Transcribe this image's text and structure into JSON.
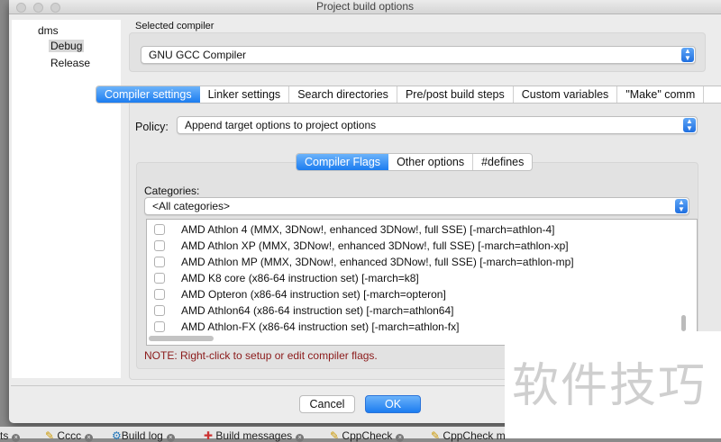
{
  "window": {
    "title": "Project build options"
  },
  "tree": {
    "root": "dms",
    "items": [
      "Debug",
      "Release"
    ],
    "selected": "Debug"
  },
  "compiler": {
    "label": "Selected compiler",
    "value": "GNU GCC Compiler"
  },
  "main_tabs": [
    "Compiler settings",
    "Linker settings",
    "Search directories",
    "Pre/post build steps",
    "Custom variables",
    "\"Make\" comm"
  ],
  "policy": {
    "label": "Policy:",
    "value": "Append target options to project options"
  },
  "sub_tabs": [
    "Compiler Flags",
    "Other options",
    "#defines"
  ],
  "categories": {
    "label": "Categories:",
    "value": "<All categories>"
  },
  "flags": [
    "AMD Athlon 4 (MMX, 3DNow!, enhanced 3DNow!, full SSE)  [-march=athlon-4]",
    "AMD Athlon XP (MMX, 3DNow!, enhanced 3DNow!, full SSE)  [-march=athlon-xp]",
    "AMD Athlon MP (MMX, 3DNow!, enhanced 3DNow!, full SSE)  [-march=athlon-mp]",
    "AMD K8 core (x86-64 instruction set)  [-march=k8]",
    "AMD Opteron (x86-64 instruction set)  [-march=opteron]",
    "AMD Athlon64 (x86-64 instruction set)  [-march=athlon64]",
    "AMD Athlon-FX (x86-64 instruction set)  [-march=athlon-fx]"
  ],
  "note": "NOTE: Right-click to setup or edit compiler flags.",
  "buttons": {
    "cancel": "Cancel",
    "ok": "OK"
  },
  "watermark": "软件技巧",
  "bottom_tabs": [
    "ts",
    "Cccc",
    "Build log",
    "Build messages",
    "CppCheck",
    "CppCheck m"
  ],
  "colors": {
    "accent": "#1c7cf0",
    "note": "#8b1a1a"
  }
}
